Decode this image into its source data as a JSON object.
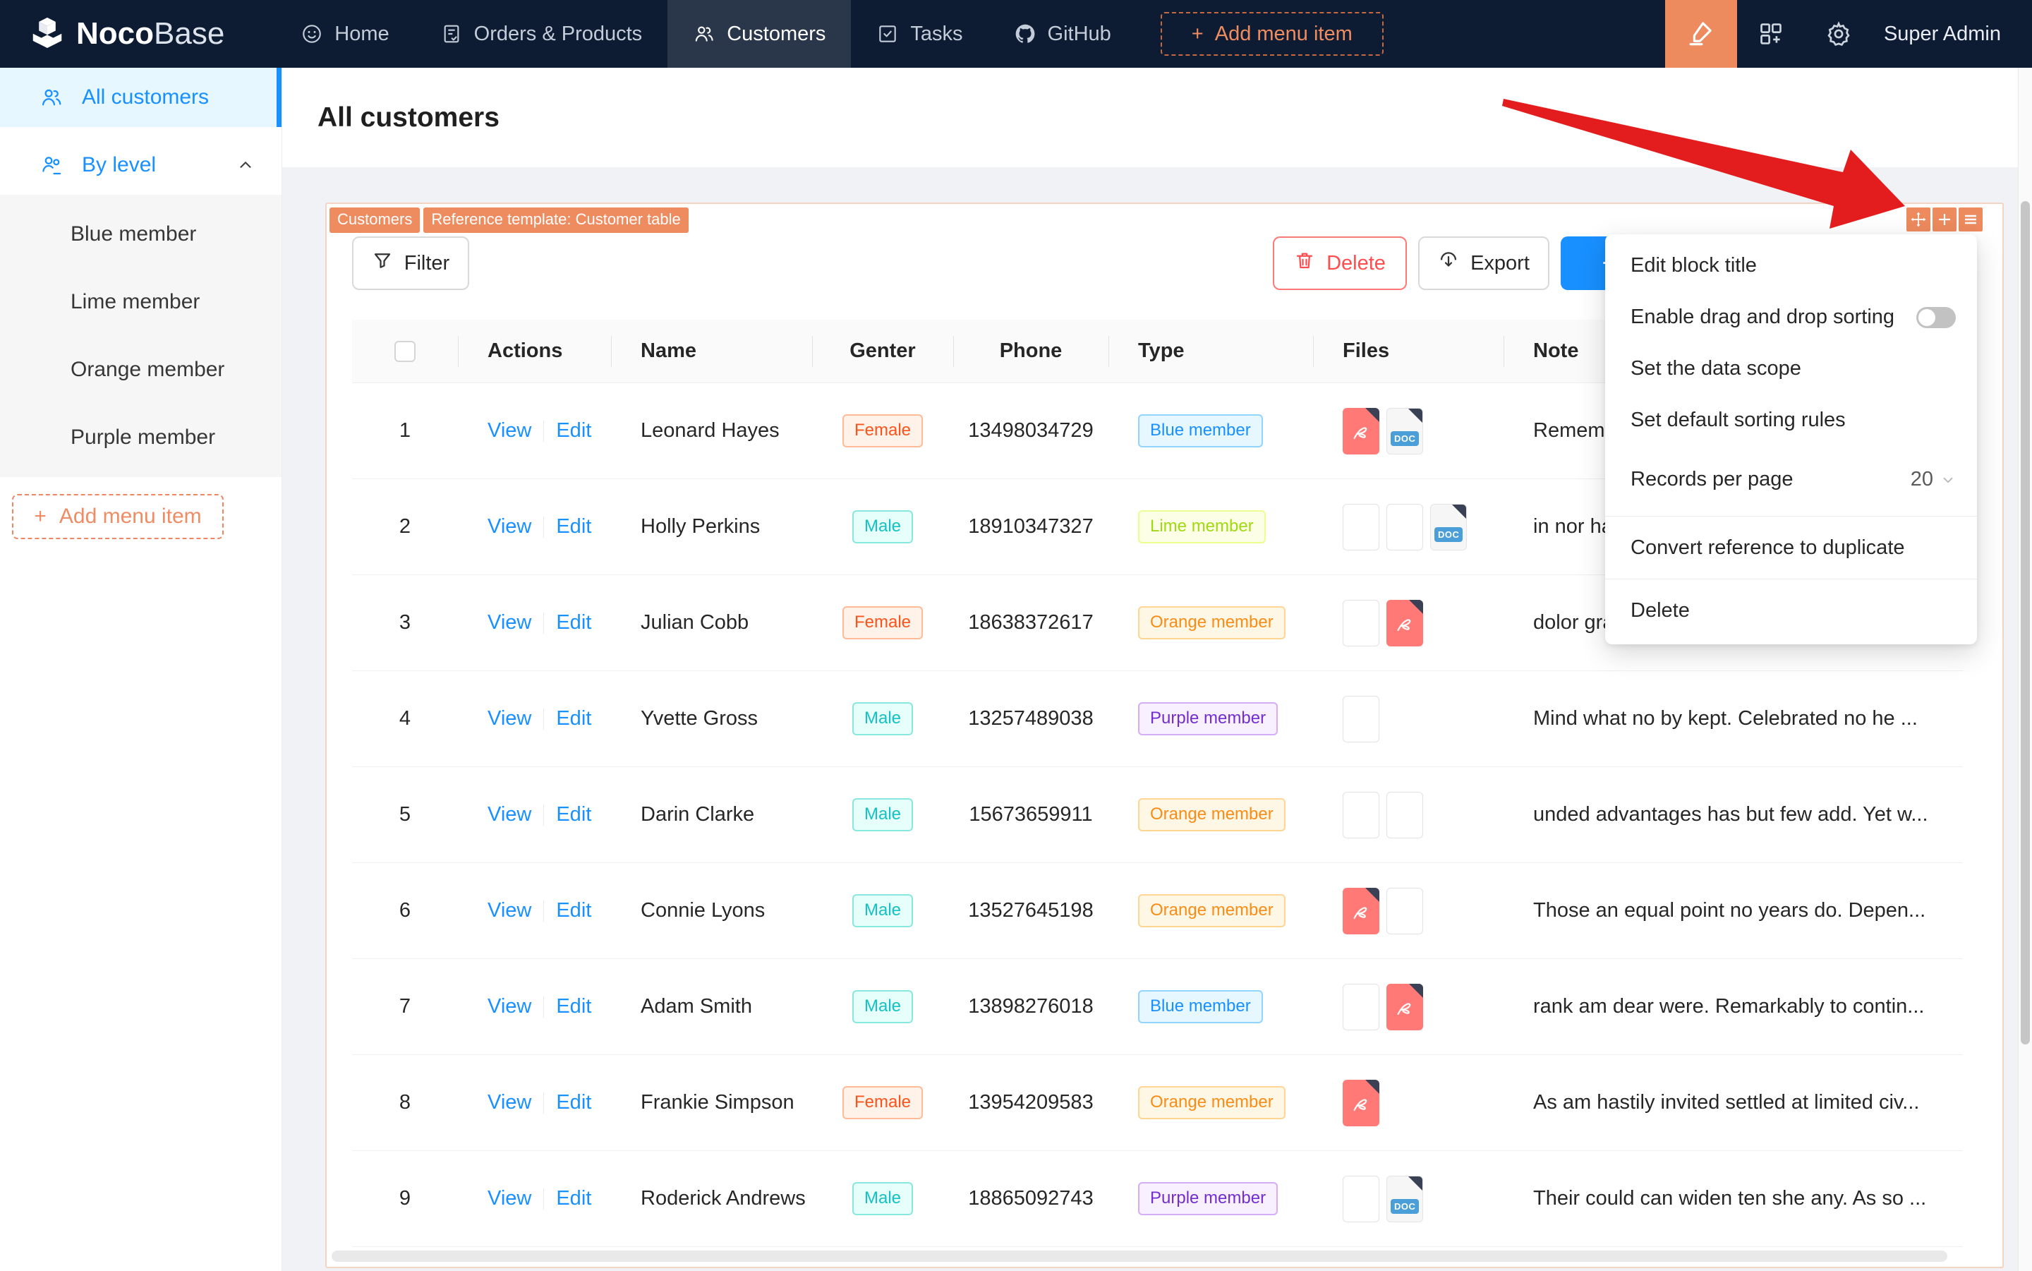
{
  "navbar": {
    "logo_bold": "Noco",
    "logo_light": "Base",
    "items": [
      {
        "label": "Home",
        "icon": "home-icon",
        "active": false
      },
      {
        "label": "Orders & Products",
        "icon": "orders-icon",
        "active": false
      },
      {
        "label": "Customers",
        "icon": "people-icon",
        "active": true
      },
      {
        "label": "Tasks",
        "icon": "tasks-icon",
        "active": false
      },
      {
        "label": "GitHub",
        "icon": "github-icon",
        "active": false
      }
    ],
    "add_menu_item_label": "Add menu item",
    "user": "Super Admin"
  },
  "sidebar": {
    "items": [
      {
        "label": "All customers",
        "icon": "people-icon",
        "active": true
      },
      {
        "label": "By level",
        "icon": "people-level-icon",
        "expanded": true,
        "children": [
          "Blue member",
          "Lime member",
          "Orange member",
          "Purple member"
        ]
      }
    ],
    "add_menu_item_label": "Add menu item"
  },
  "page": {
    "title": "All customers"
  },
  "block": {
    "designer_tags": [
      "Customers",
      "Reference template: Customer table"
    ],
    "toolbar": {
      "filter_label": "Filter",
      "delete_label": "Delete",
      "export_label": "Export",
      "add_label": "+"
    },
    "table": {
      "columns": [
        "",
        "Actions",
        "Name",
        "Genter",
        "Phone",
        "Type",
        "Files",
        "Note"
      ],
      "action_labels": [
        "View",
        "Edit"
      ],
      "rows": [
        {
          "index": "1",
          "name": "Leonard Hayes",
          "gender": "Female",
          "gender_palette": "volcano",
          "phone": "13498034729",
          "type": "Blue member",
          "type_palette": "blue",
          "files": [
            {
              "kind": "pdf"
            },
            {
              "kind": "doc"
            }
          ],
          "note": "Remember"
        },
        {
          "index": "2",
          "name": "Holly Perkins",
          "gender": "Male",
          "gender_palette": "cyan",
          "phone": "18910347327",
          "type": "Lime member",
          "type_palette": "lime",
          "files": [
            {
              "kind": "img",
              "variant": "oranges"
            },
            {
              "kind": "img",
              "variant": "plants"
            },
            {
              "kind": "doc"
            }
          ],
          "note": "in nor ham"
        },
        {
          "index": "3",
          "name": "Julian Cobb",
          "gender": "Female",
          "gender_palette": "volcano",
          "phone": "18638372617",
          "type": "Orange member",
          "type_palette": "orange",
          "files": [
            {
              "kind": "img",
              "variant": "food"
            },
            {
              "kind": "pdf"
            }
          ],
          "note": "dolor graeco pro, te sea bonorum doloru..."
        },
        {
          "index": "4",
          "name": "Yvette Gross",
          "gender": "Male",
          "gender_palette": "cyan",
          "phone": "13257489038",
          "type": "Purple member",
          "type_palette": "purple",
          "files": [
            {
              "kind": "img",
              "variant": "pastry"
            }
          ],
          "note": "Mind what no by kept. Celebrated no he ..."
        },
        {
          "index": "5",
          "name": "Darin Clarke",
          "gender": "Male",
          "gender_palette": "cyan",
          "phone": "15673659911",
          "type": "Orange member",
          "type_palette": "orange",
          "files": [
            {
              "kind": "img",
              "variant": "crate"
            },
            {
              "kind": "img",
              "variant": "crate2"
            }
          ],
          "note": "unded advantages has but few add. Yet w..."
        },
        {
          "index": "6",
          "name": "Connie Lyons",
          "gender": "Male",
          "gender_palette": "cyan",
          "phone": "13527645198",
          "type": "Orange member",
          "type_palette": "orange",
          "files": [
            {
              "kind": "pdf"
            },
            {
              "kind": "img",
              "variant": "citrus"
            }
          ],
          "note": "Those an equal point no years do. Depen..."
        },
        {
          "index": "7",
          "name": "Adam Smith",
          "gender": "Male",
          "gender_palette": "cyan",
          "phone": "13898276018",
          "type": "Blue member",
          "type_palette": "blue",
          "files": [
            {
              "kind": "img",
              "variant": "coffee"
            },
            {
              "kind": "pdf"
            }
          ],
          "note": "rank am dear were. Remarkably to contin..."
        },
        {
          "index": "8",
          "name": "Frankie Simpson",
          "gender": "Female",
          "gender_palette": "volcano",
          "phone": "13954209583",
          "type": "Orange member",
          "type_palette": "orange",
          "files": [
            {
              "kind": "pdf"
            }
          ],
          "note": "As am hastily invited settled at limited civ..."
        },
        {
          "index": "9",
          "name": "Roderick Andrews",
          "gender": "Male",
          "gender_palette": "cyan",
          "phone": "18865092743",
          "type": "Purple member",
          "type_palette": "purple",
          "files": [
            {
              "kind": "img",
              "variant": "shelf"
            },
            {
              "kind": "doc"
            }
          ],
          "note": "Their could can widen ten she any. As so ..."
        }
      ]
    }
  },
  "block_settings_menu": {
    "items": [
      {
        "type": "item",
        "label": "Edit block title"
      },
      {
        "type": "toggle",
        "label": "Enable drag and drop sorting",
        "state": "off"
      },
      {
        "type": "item",
        "label": "Set the data scope"
      },
      {
        "type": "item",
        "label": "Set default sorting rules"
      },
      {
        "type": "select",
        "label": "Records per page",
        "value": "20"
      },
      {
        "type": "divider"
      },
      {
        "type": "item",
        "label": "Convert reference to duplicate"
      },
      {
        "type": "divider"
      },
      {
        "type": "item",
        "label": "Delete"
      }
    ]
  },
  "colors": {
    "navbar_bg": "#0d1c33",
    "accent_orange": "#ed8a5e",
    "primary_blue": "#1890ff",
    "danger_red": "#ff4d4f",
    "arrow_red": "#e31d1d",
    "card_border": "#f2d4c0"
  }
}
